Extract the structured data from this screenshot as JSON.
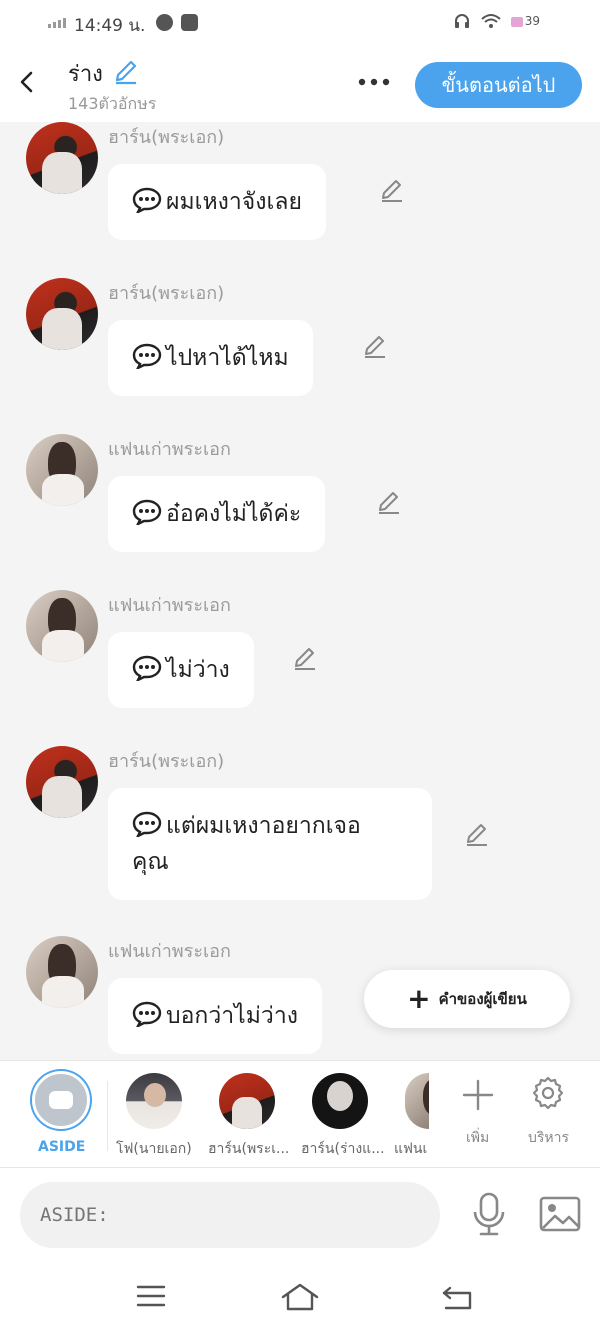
{
  "status_bar": {
    "time": "14:49",
    "carrier_suffix": "น.",
    "battery": "39"
  },
  "header": {
    "title": "ร่าง",
    "subtitle": "143ตัวอักษร",
    "next_button_label": "ขั้นตอนต่อไป"
  },
  "messages": [
    {
      "sender": "ฮาร์น(พระเอก)",
      "text": "ผมเหงาจังเลย",
      "avatar": "hero"
    },
    {
      "sender": "ฮาร์น(พระเอก)",
      "text": "ไปหาได้ไหม",
      "avatar": "hero"
    },
    {
      "sender": "แฟนเก่าพระเอก",
      "text": "อ๋อคงไม่ได้ค่ะ",
      "avatar": "ex"
    },
    {
      "sender": "แฟนเก่าพระเอก",
      "text": "ไม่ว่าง",
      "avatar": "ex"
    },
    {
      "sender": "ฮาร์น(พระเอก)",
      "text": "แต่ผมเหงาอยากเจอ",
      "text_line2": "คุณ",
      "avatar": "hero"
    },
    {
      "sender": "แฟนเก่าพระเอก",
      "text": "บอกว่าไม่ว่าง",
      "avatar": "ex"
    }
  ],
  "author_button_label": "คำของผู้เขียน",
  "characters": {
    "aside_label": "ASIDE",
    "items": [
      {
        "label": "โฟ(นายเอก)"
      },
      {
        "label": "ฮาร์น(พระเ..."
      },
      {
        "label": "ฮาร์น(ร่างแ..."
      },
      {
        "label": "แฟนเ"
      }
    ],
    "add_label": "เพิ่ม",
    "manage_label": "บริหาร"
  },
  "input": {
    "placeholder": "ASIDE:"
  },
  "colors": {
    "accent": "#4aa3ec",
    "background": "#f4f4f5"
  }
}
